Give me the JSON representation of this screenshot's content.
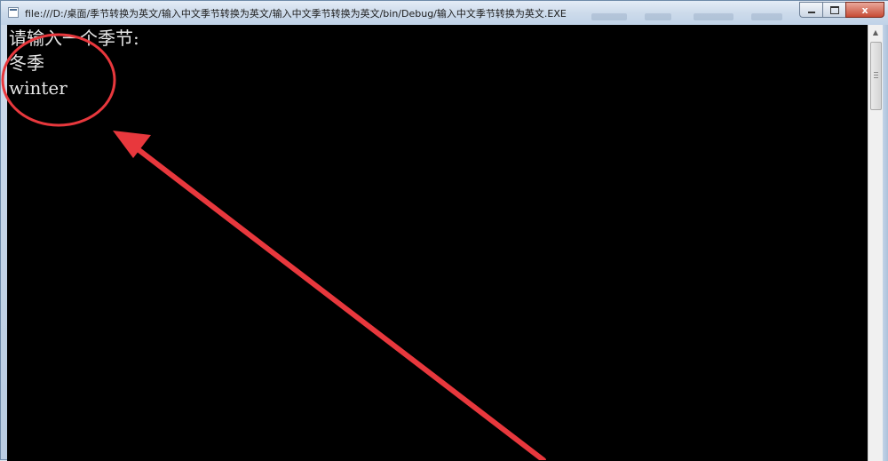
{
  "window": {
    "title": "file:///D:/桌面/季节转换为英文/输入中文季节转换为英文/输入中文季节转换为英文/bin/Debug/输入中文季节转换为英文.EXE",
    "controls": {
      "minimize_icon": "minimize-icon",
      "maximize_icon": "maximize-icon",
      "close_icon": "close-icon",
      "close_glyph": "x"
    }
  },
  "console": {
    "lines": [
      "请输入一个季节:",
      "冬季",
      "winter"
    ],
    "background": "#000000",
    "text_color": "#e6e6e6"
  },
  "annotation": {
    "color": "#e8383d",
    "shapes": [
      "ellipse",
      "arrow"
    ]
  }
}
